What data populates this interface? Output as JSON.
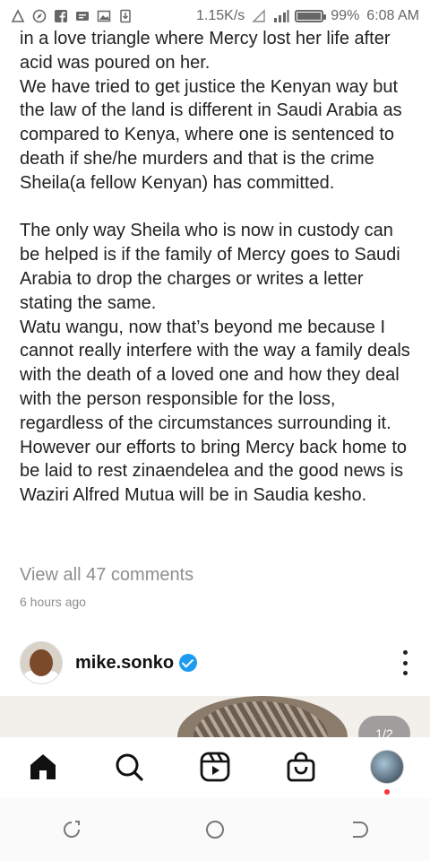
{
  "status_bar": {
    "speed": "1.15K/s",
    "battery": "99%",
    "battery_level": 0.99,
    "time": "6:08 AM",
    "icons": [
      "alert-icon",
      "browser-icon",
      "facebook-icon",
      "message-icon",
      "image-icon",
      "download-icon",
      "mute-icon",
      "signal-icon",
      "battery-icon"
    ]
  },
  "post": {
    "caption_paragraphs": [
      "in a love triangle where  Mercy lost her life after acid was poured on her.\nWe have tried to get justice the Kenyan way but the law of the land is different in Saudi Arabia as compared to Kenya, where one  is sentenced to death if she/he murders and that is the crime Sheila(a fellow Kenyan) has committed.",
      "The only way Sheila who is now in custody can be helped is if the family of Mercy goes to Saudi Arabia to drop the charges or writes a letter stating the same.\nWatu wangu, now that’s beyond me because I cannot really interfere with the way a family deals with the death of a loved one and how they deal with the person responsible for the loss, regardless of the circumstances surrounding it. However our efforts to bring Mercy back home to be laid to rest zinaendelea and the good news is Waziri Alfred Mutua will be in Saudia kesho."
    ],
    "view_comments": "View all 47 comments",
    "time_ago": "6 hours ago"
  },
  "next_post": {
    "username": "mike.sonko",
    "verified": true,
    "media_counter": "1/2"
  },
  "tab_bar": {
    "items": [
      "home-icon",
      "search-icon",
      "reels-icon",
      "shop-icon",
      "profile-avatar"
    ]
  },
  "nav_bar": {
    "items": [
      "recents-button",
      "home-button",
      "back-button"
    ]
  }
}
